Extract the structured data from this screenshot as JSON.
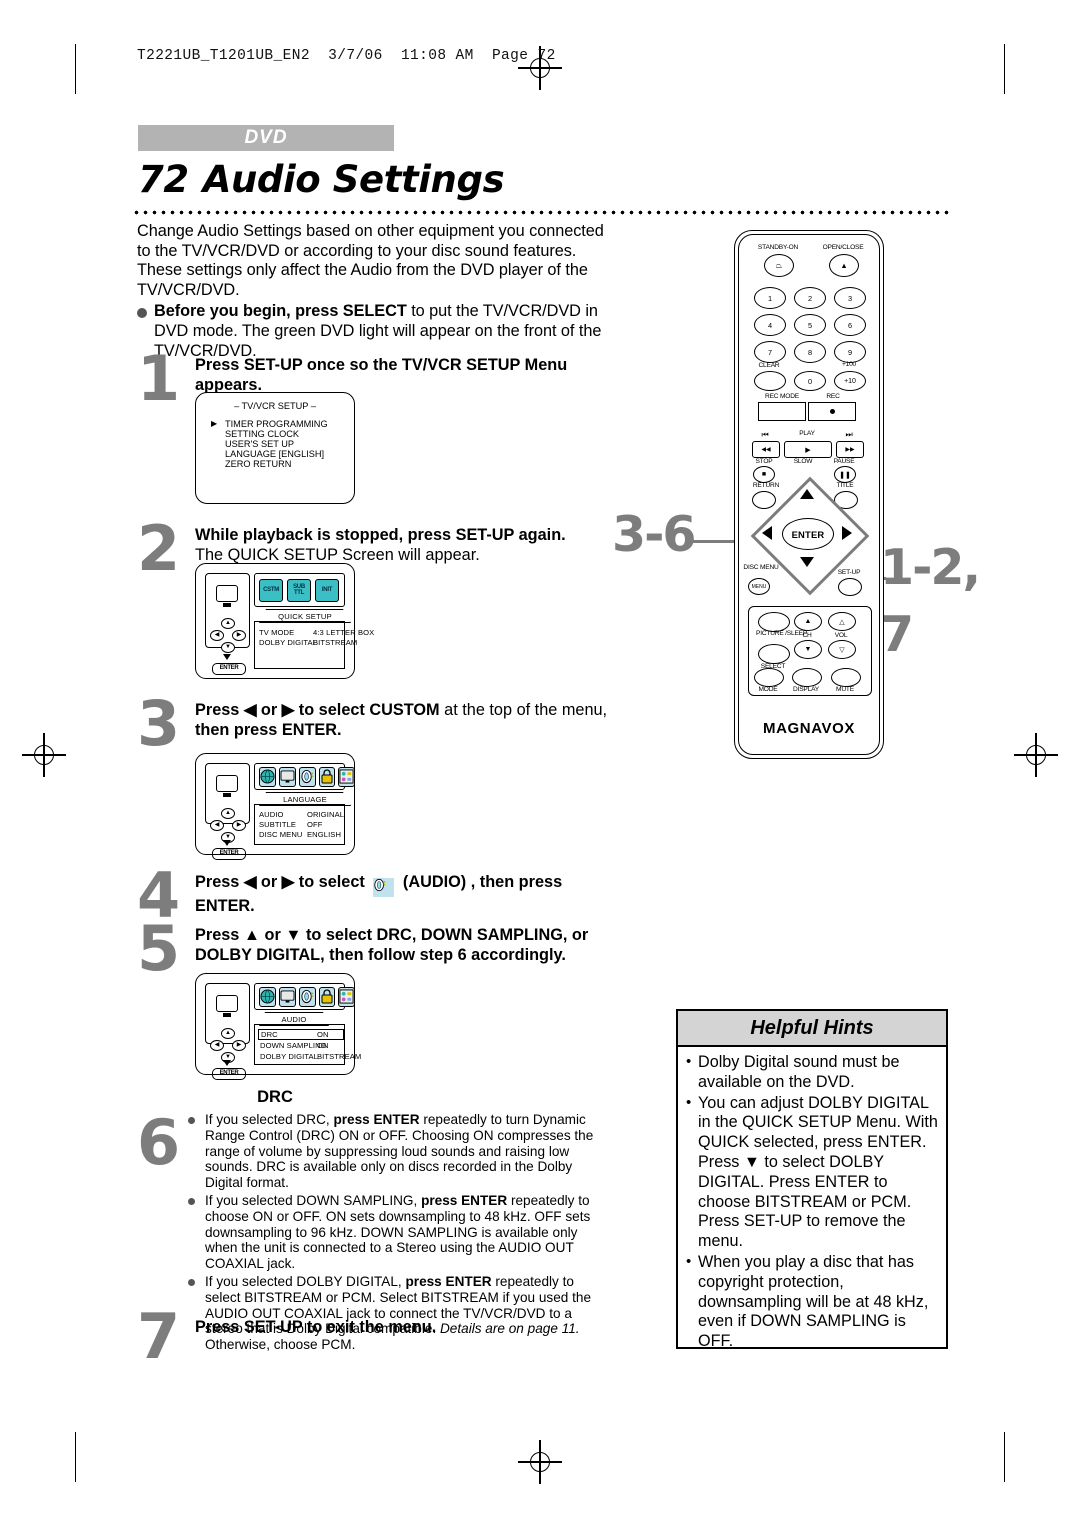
{
  "print_header": "T2221UB_T1201UB_EN2  3/7/06  11:08 AM  Page 72",
  "section_tag": "DVD",
  "page_number": "72",
  "page_title": "Audio Settings",
  "intro": {
    "paragraph": "Change Audio Settings based on other equipment you connected to the TV/VCR/DVD or according to your disc sound features.  These settings only affect the Audio from the DVD player of the TV/VCR/DVD.",
    "bullet_bold": "Before you begin, press SELECT",
    "bullet_rest": " to put the TV/VCR/DVD in DVD mode.  The green DVD light will appear on the front of the TV/VCR/DVD."
  },
  "steps": {
    "one": {
      "number": "1",
      "bold": "Press SET-UP once so the TV/VCR SETUP Menu appears.",
      "screen": {
        "title": "– TV/VCR SETUP –",
        "cursor": "▶",
        "items": [
          "TIMER PROGRAMMING",
          "SETTING CLOCK",
          "USER'S SET UP",
          "LANGUAGE  [ENGLISH]",
          "ZERO RETURN"
        ]
      }
    },
    "two": {
      "number": "2",
      "bold": "While playback is stopped, press SET-UP again.",
      "normal": "The QUICK SETUP Screen will appear.",
      "screen": {
        "icons": [
          "CSTM",
          "SUB TTL",
          "INIT"
        ],
        "tab": "QUICK SETUP",
        "rows": [
          {
            "label": "TV MODE",
            "value": "4:3 LETTER BOX"
          },
          {
            "label": "DOLBY DIGITAL",
            "value": "BITSTREAM"
          }
        ],
        "enter_chip": "ENTER"
      }
    },
    "three": {
      "number": "3",
      "text_pre_bold": "Press ",
      "text_arrows": "◀ or ▶",
      "text_mid_bold": " to select CUSTOM",
      "text_normal": " at the top of the menu, ",
      "text_end_bold": "then press ENTER.",
      "screen": {
        "icons": [
          "globe",
          "tv",
          "audio",
          "lock",
          "other"
        ],
        "tab": "LANGUAGE",
        "rows": [
          {
            "label": "AUDIO",
            "value": "ORIGINAL"
          },
          {
            "label": "SUBTITLE",
            "value": "OFF"
          },
          {
            "label": "DISC MENU",
            "value": "ENGLISH"
          }
        ],
        "enter_chip": "ENTER"
      }
    },
    "four": {
      "number": "4",
      "part1": "Press ◀ or ▶ to select",
      "icon_label": "audio-icon",
      "part2": "(AUDIO) , then press ENTER."
    },
    "five": {
      "number": "5",
      "bold": "Press ▲ or ▼ to select DRC, DOWN SAMPLING, or DOLBY DIGITAL, then follow step 6 accordingly.",
      "screen": {
        "icons": [
          "globe",
          "tv",
          "audio",
          "lock",
          "other"
        ],
        "tab": "AUDIO",
        "rows": [
          {
            "label": "DRC",
            "value": "ON",
            "highlighted": true
          },
          {
            "label": "DOWN SAMPLING",
            "value": "ON",
            "highlighted": false
          },
          {
            "label": "DOLBY DIGITAL",
            "value": "BITSTREAM",
            "highlighted": false
          }
        ],
        "enter_chip": "ENTER"
      }
    },
    "six": {
      "number": "6",
      "heading": "DRC",
      "bullets": [
        {
          "a": "If you selected DRC, ",
          "b": "press ENTER",
          "c": " repeatedly to turn Dynamic Range Control (DRC) ON or OFF. Choosing ON compresses the range of volume by suppressing loud sounds and raising low sounds. DRC is available only on discs recorded in the Dolby Digital format."
        },
        {
          "a": "If you selected DOWN SAMPLING, ",
          "b": "press ENTER",
          "c": " repeatedly to choose ON or OFF. ON sets downsampling to 48 kHz. OFF sets downsampling to 96 kHz. DOWN SAMPLING is available only when the unit is connected to a Stereo using the AUDIO OUT COAXIAL jack."
        },
        {
          "a": "If you selected DOLBY DIGITAL, ",
          "b": "press ENTER",
          "c": " repeatedly to select BITSTREAM or PCM. Select BITSTREAM if you used the AUDIO OUT COAXIAL jack to connect the TV/VCR/DVD to a stereo that is Dolby Digital compatible. ",
          "d": "Details are on page 11.",
          "e": " Otherwise, choose PCM."
        }
      ]
    },
    "seven": {
      "number": "7",
      "bold": "Press SET-UP to exit the menu."
    }
  },
  "callouts": {
    "left": "3-6",
    "right_top": "1-2,",
    "right_bottom": "7"
  },
  "remote": {
    "standby": "STANDBY-ON",
    "open_close": "OPEN/CLOSE",
    "keys": [
      "1",
      "2",
      "3",
      "4",
      "5",
      "6",
      "7",
      "8",
      "9",
      "0"
    ],
    "clear": "CLEAR",
    "plus100": "+100",
    "plus10": "+10",
    "rec_mode": "REC MODE",
    "rec": "REC",
    "play": "PLAY",
    "rew": "◀◀",
    "ff": "▶▶",
    "prev": "⏮",
    "next": "⏭",
    "stop": "STOP",
    "slow": "SLOW",
    "pause": "PAUSE",
    "return": "RETURN",
    "title": "TITLE",
    "enter": "ENTER",
    "disc_menu": "DISC MENU",
    "setup": "SET-UP",
    "picture_sleep": "PICTURE /SLEEP",
    "select": "SELECT",
    "ch": "CH",
    "vol": "VOL",
    "mode": "MODE",
    "display": "DISPLAY",
    "mute": "MUTE",
    "brand": "MAGNAVOX"
  },
  "hints": {
    "title": "Helpful Hints",
    "items": [
      "Dolby Digital sound must be available on the DVD.",
      "You can adjust DOLBY DIGITAL in the QUICK SETUP Menu. With QUICK selected, press ENTER. Press ▼ to select DOLBY DIGITAL. Press ENTER to choose BITSTREAM or PCM. Press SET-UP to remove the menu.",
      "When you play a disc that has copyright protection, downsampling will be at 48 kHz, even if DOWN SAMPLING is OFF."
    ]
  },
  "colors": {
    "gray_number": "#7d7d7d",
    "tag_bg": "#b3b3b3",
    "hints_header": "#d4d4d4",
    "icon_teal": "#3bbfc0"
  }
}
